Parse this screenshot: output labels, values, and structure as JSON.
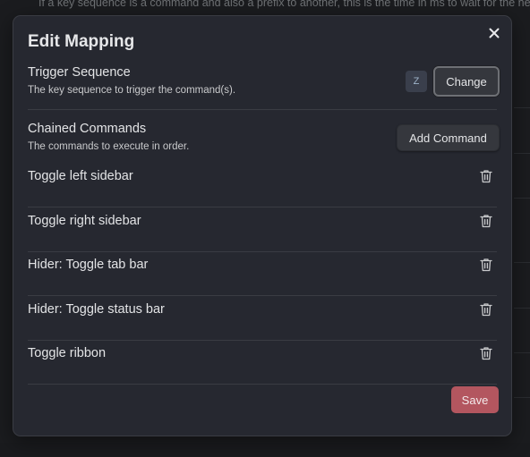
{
  "background": {
    "text": "If a key sequence is a command and also a prefix to another, this is the time in ms to wait for the next key"
  },
  "modal": {
    "title": "Edit Mapping",
    "close_icon": "close-icon",
    "trigger": {
      "name": "Trigger Sequence",
      "description": "The key sequence to trigger the command(s).",
      "key": "Z",
      "change_label": "Change"
    },
    "chained": {
      "name": "Chained Commands",
      "description": "The commands to execute in order.",
      "add_label": "Add Command"
    },
    "commands": [
      {
        "label": "Toggle left sidebar",
        "icon": "trash-icon"
      },
      {
        "label": "Toggle right sidebar",
        "icon": "trash-icon"
      },
      {
        "label": "Hider: Toggle tab bar",
        "icon": "trash-icon"
      },
      {
        "label": "Hider: Toggle status bar",
        "icon": "trash-icon"
      },
      {
        "label": "Toggle ribbon",
        "icon": "trash-icon"
      }
    ],
    "save_label": "Save"
  },
  "colors": {
    "modal_bg": "#262830",
    "save_accent": "#b3565f",
    "key_badge_bg": "#3a3f4c"
  }
}
